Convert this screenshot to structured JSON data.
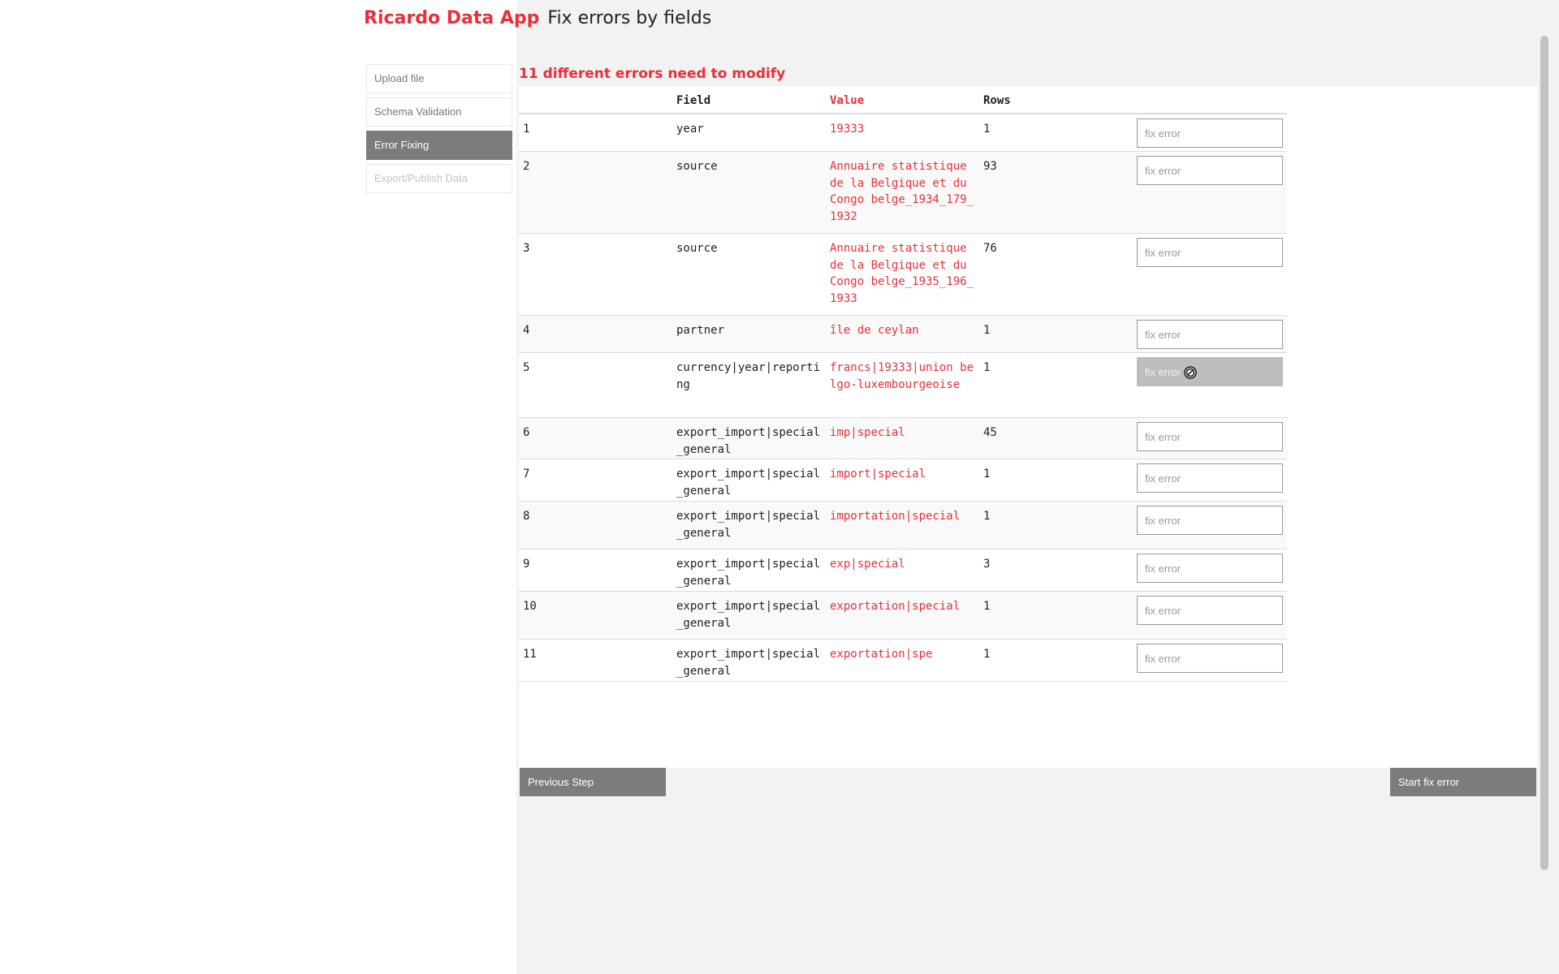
{
  "header": {
    "brand": "Ricardo Data App",
    "title": "Fix errors by fields"
  },
  "sidebar": {
    "items": [
      {
        "label": "Upload file",
        "state": "normal"
      },
      {
        "label": "Schema Validation",
        "state": "normal"
      },
      {
        "label": "Error Fixing",
        "state": "active"
      },
      {
        "label": "Export/Publish Data",
        "state": "disabled"
      }
    ]
  },
  "main": {
    "heading": "11 different errors need to modify",
    "columns": {
      "field": "Field",
      "value": "Value",
      "rows": "Rows"
    },
    "input_placeholder": "fix error",
    "rows": [
      {
        "num": "1",
        "field": "year",
        "value": "19333",
        "rows": "1"
      },
      {
        "num": "2",
        "field": "source",
        "value": "Annuaire statistique de la Belgique et du Congo belge_1934_179_1932",
        "rows": "93"
      },
      {
        "num": "3",
        "field": "source",
        "value": "Annuaire statistique de la Belgique et du Congo belge_1935_196_1933",
        "rows": "76"
      },
      {
        "num": "4",
        "field": "partner",
        "value": "île de ceylan",
        "rows": "1"
      },
      {
        "num": "5",
        "field": "currency|year|reporting",
        "value": "francs|19333|union belgo-luxembourgeoise",
        "rows": "1"
      },
      {
        "num": "6",
        "field": "export_import|special_general",
        "value": "imp|special",
        "rows": "45"
      },
      {
        "num": "7",
        "field": "export_import|special_general",
        "value": "import|special",
        "rows": "1"
      },
      {
        "num": "8",
        "field": "export_import|special_general",
        "value": "importation|special",
        "rows": "1"
      },
      {
        "num": "9",
        "field": "export_import|special_general",
        "value": "exp|special",
        "rows": "3"
      },
      {
        "num": "10",
        "field": "export_import|special_general",
        "value": "exportation|special",
        "rows": "1"
      },
      {
        "num": "11",
        "field": "export_import|special_general",
        "value": "exportation|spe",
        "rows": "1"
      }
    ]
  },
  "footer": {
    "previous_label": "Previous Step",
    "start_label": "Start fix error"
  },
  "colors": {
    "accent": "#e8303a",
    "button_grey": "#7c7c7c"
  }
}
